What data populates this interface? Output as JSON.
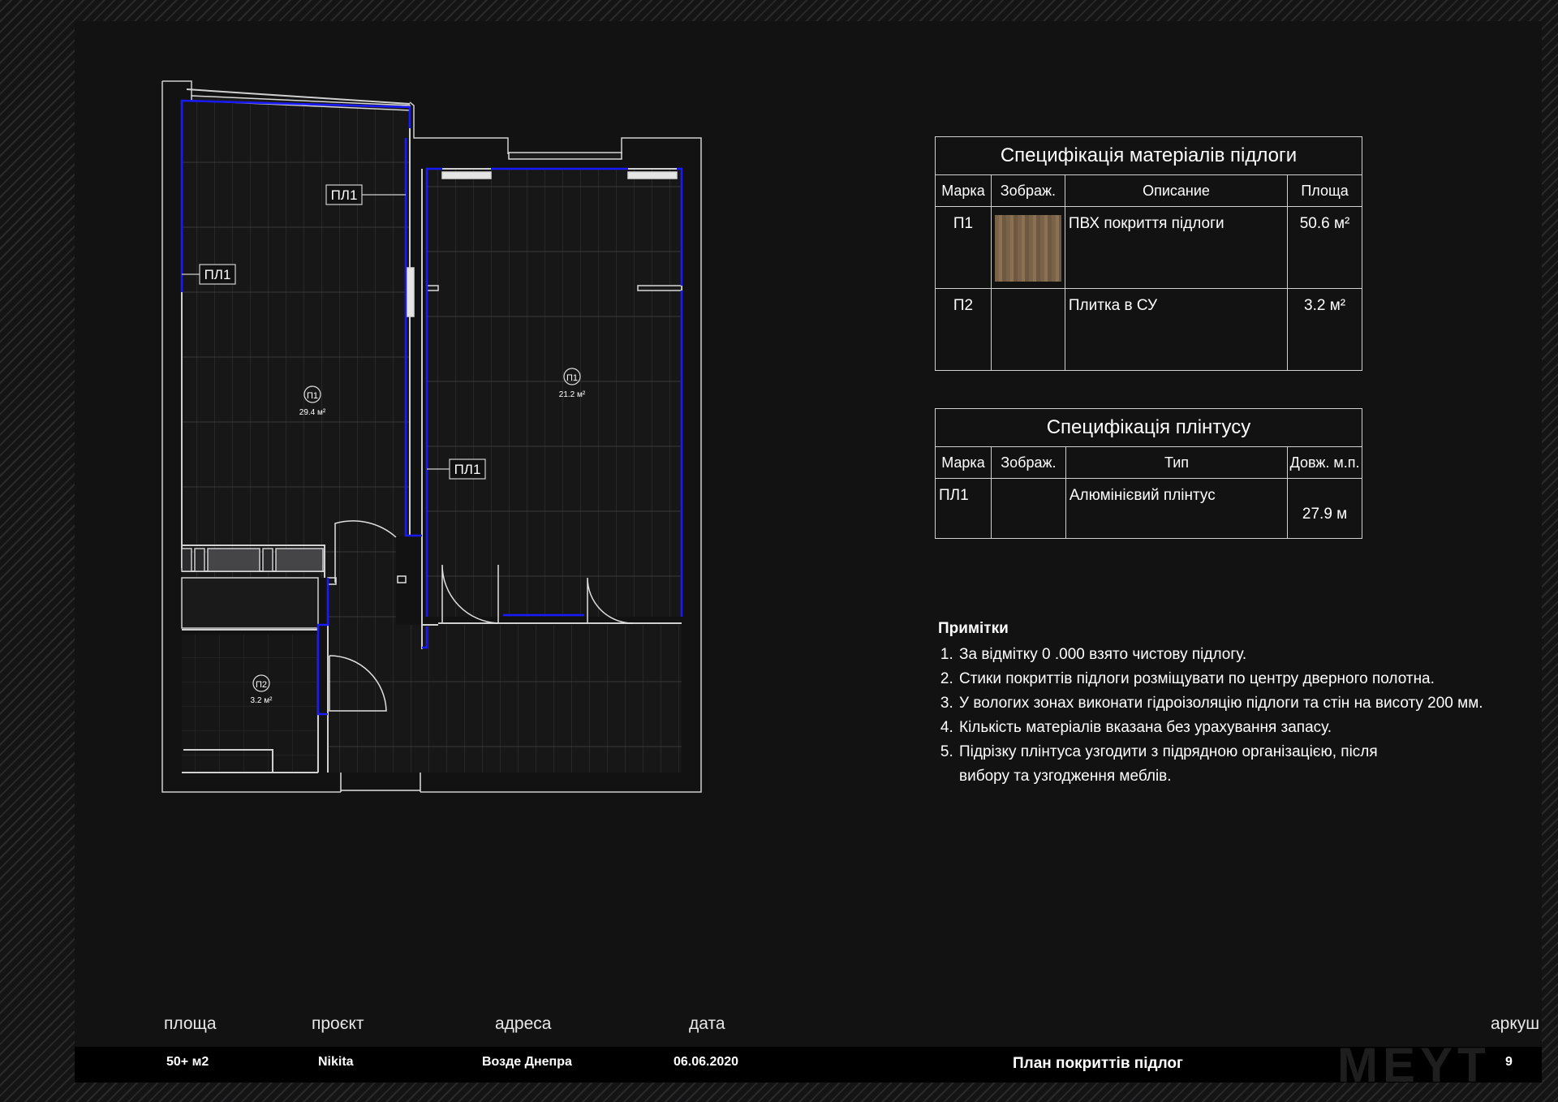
{
  "plan": {
    "tags": [
      "ПЛ1",
      "ПЛ1",
      "ПЛ1"
    ],
    "rooms": [
      {
        "mark": "П1",
        "area": "29.4 м²"
      },
      {
        "mark": "П1",
        "area": "21.2 м²"
      },
      {
        "mark": "П2",
        "area": "3.2 м²"
      }
    ]
  },
  "floor_spec": {
    "title": "Специфікація матеріалів підлоги",
    "headers": [
      "Марка",
      "Зображ.",
      "Описание",
      "Площа"
    ],
    "rows": [
      {
        "mark": "П1",
        "description": "ПВХ покриття підлоги",
        "area": "50.6 м²"
      },
      {
        "mark": "П2",
        "description": "Плитка в СУ",
        "area": "3.2 м²"
      }
    ]
  },
  "plinth_spec": {
    "title": "Специфікація плінтусу",
    "headers": [
      "Марка",
      "Зображ.",
      "Тип",
      "Довж. м.п."
    ],
    "rows": [
      {
        "mark": "ПЛ1",
        "type": "Алюмінієвий плінтус",
        "length": "27.9 м"
      }
    ]
  },
  "notes": {
    "title": "Примітки",
    "items": [
      "За відмітку 0 .000 взято чистову підлогу.",
      "Стики покриттів підлоги розміщувати по центру дверного полотна.",
      "У вологих зонах виконати гідроізоляцію підлоги та стін на висоту 200 мм.",
      "Кількість матеріалів вказана без урахування запасу.",
      "Підрізку плінтуса узгодити з підрядною організацією, після вибору та узгодження меблів."
    ]
  },
  "footer": {
    "labels": {
      "area": "площа",
      "project": "проєкт",
      "address": "адреса",
      "date": "дата",
      "sheet": "аркуш"
    },
    "values": {
      "area": "50+ м2",
      "project": "Nikita",
      "address": "Возде Днепра",
      "date": "06.06.2020",
      "sheet": "9"
    },
    "sheet_title": "План покриттів підлог",
    "logo": "MEYT"
  },
  "colors": {
    "background": "#111112",
    "plinth": "#1a1aff",
    "lines": "#d0d0d0"
  }
}
